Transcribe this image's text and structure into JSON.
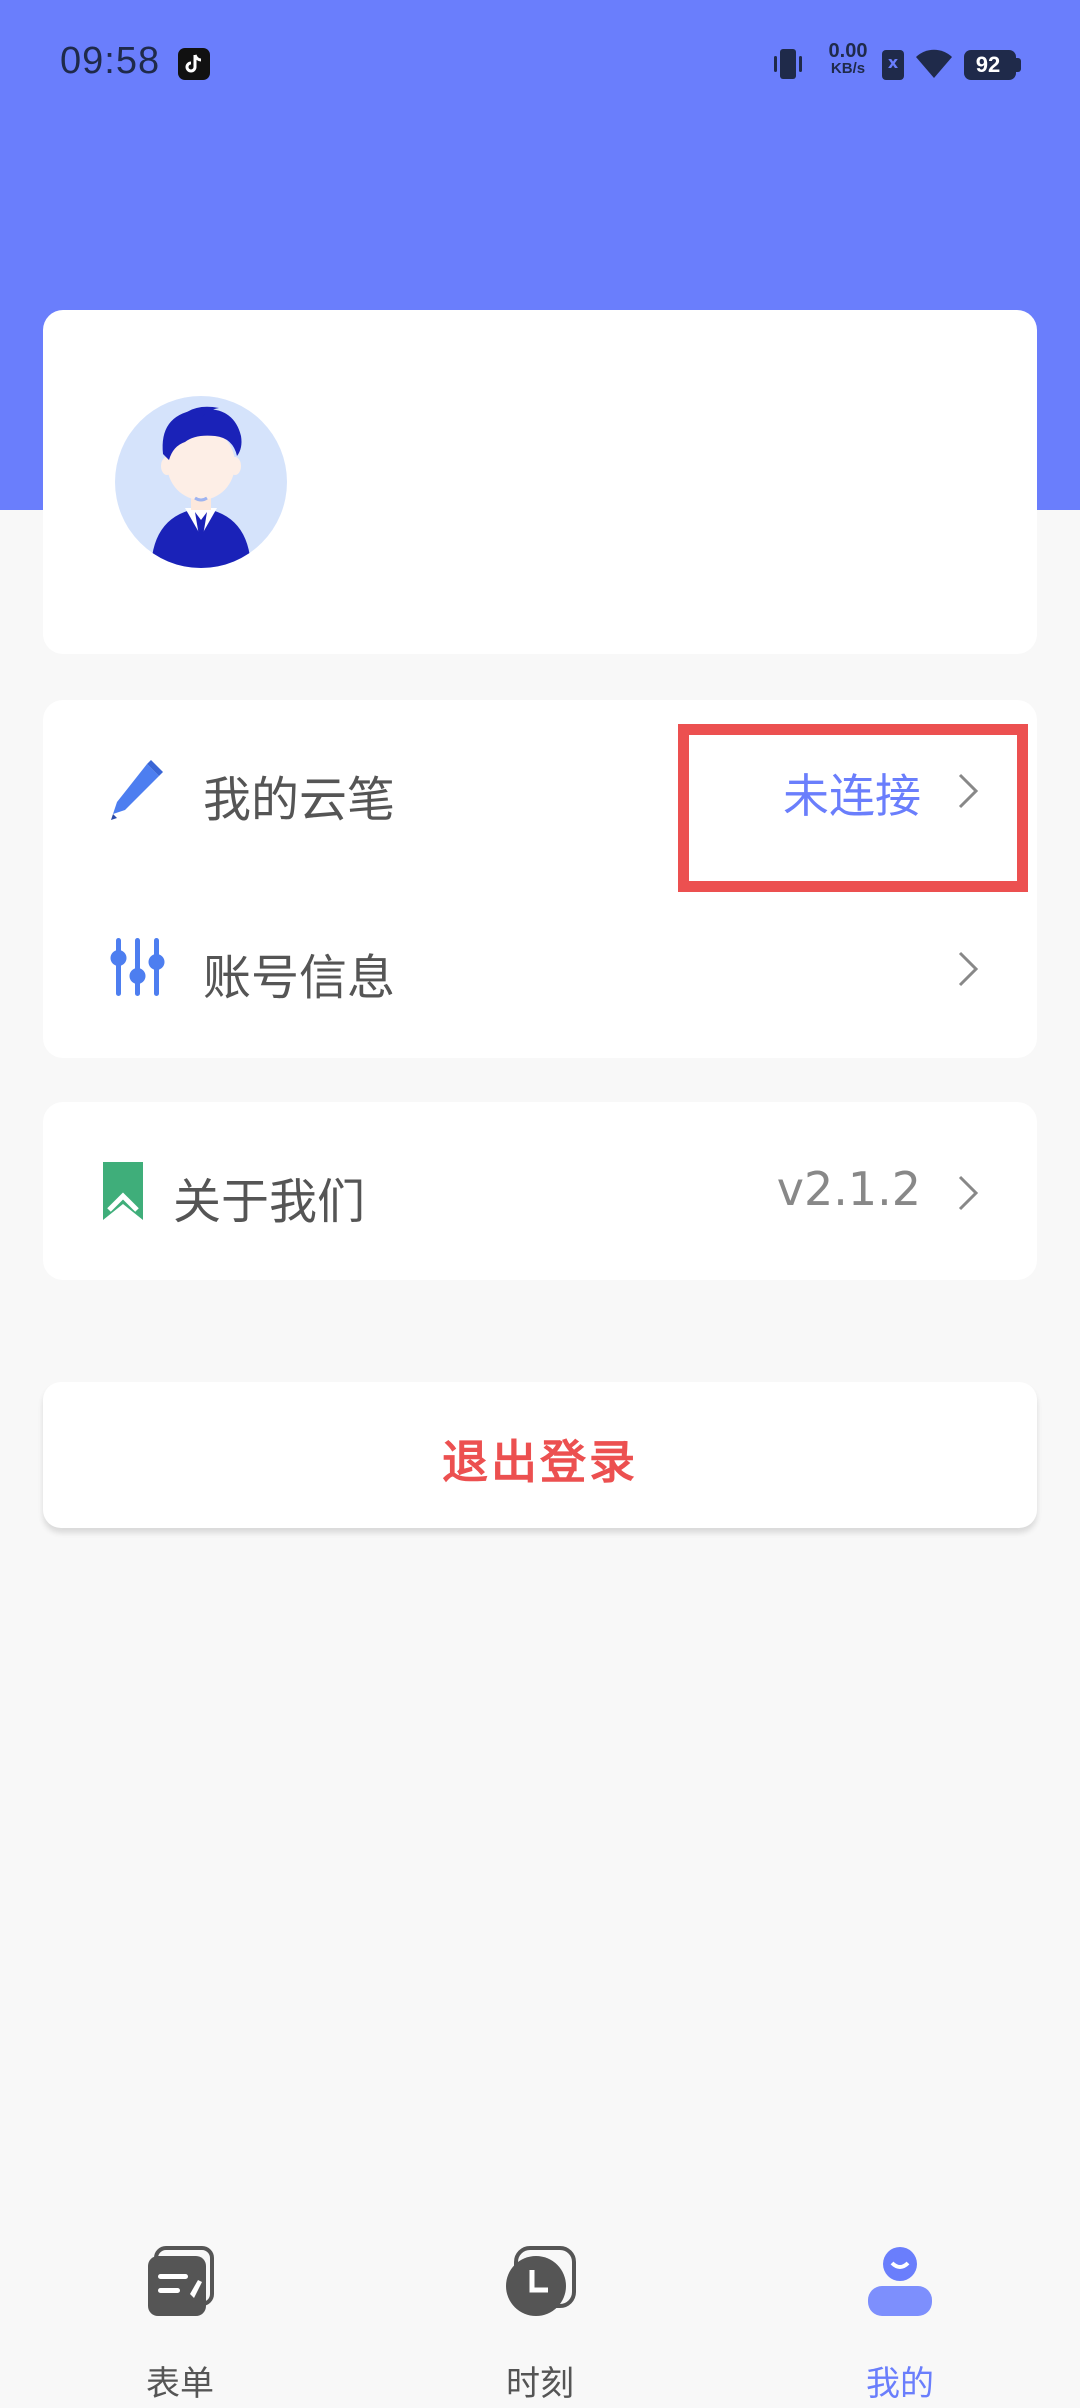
{
  "status_bar": {
    "time": "09:58",
    "net_speed_value": "0.00",
    "net_speed_unit": "KB/s",
    "battery": "92",
    "sim_mark": "x"
  },
  "colors": {
    "header": "#6a7efc",
    "accent": "#6a7efc",
    "danger": "#ec5050",
    "highlight_box": "#ec5050"
  },
  "profile": {
    "avatar_icon": "user-avatar-icon"
  },
  "menu": {
    "pen": {
      "label": "我的云笔",
      "value": "未连接",
      "icon": "pen-icon"
    },
    "account": {
      "label": "账号信息",
      "icon": "sliders-icon"
    },
    "about": {
      "label": "关于我们",
      "value": "v2.1.2",
      "icon": "bookmark-icon"
    }
  },
  "logout_label": "退出登录",
  "tabs": [
    {
      "label": "表单",
      "icon": "form-icon",
      "active": false
    },
    {
      "label": "时刻",
      "icon": "clock-icon",
      "active": false
    },
    {
      "label": "我的",
      "icon": "profile-icon",
      "active": true
    }
  ]
}
